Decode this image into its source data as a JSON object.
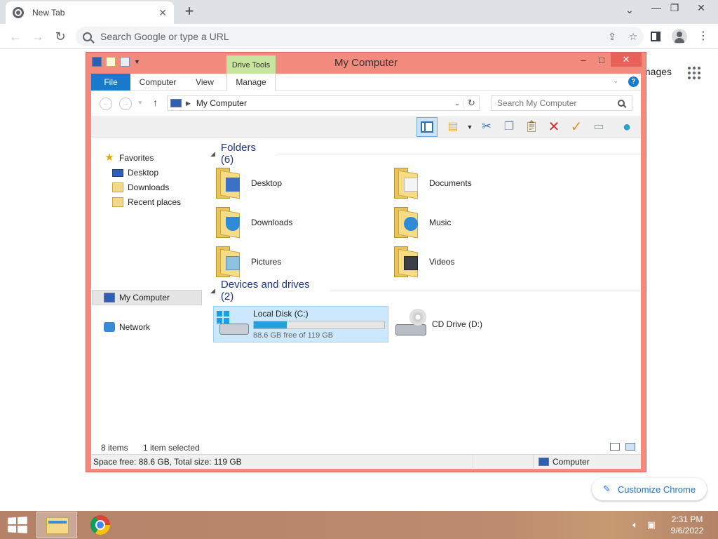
{
  "browser": {
    "tab_title": "New Tab",
    "tab_close": "✕",
    "new_tab": "+",
    "omnibox_placeholder": "Search Google or type a URL",
    "ntp_images_link": "mages",
    "customize_label": "Customize Chrome"
  },
  "explorer": {
    "title": "My Computer",
    "contextual_tab": "Drive Tools",
    "ribbon_tabs": [
      "File",
      "Computer",
      "View",
      "Manage"
    ],
    "address_text": "My Computer",
    "search_placeholder": "Search My Computer",
    "nav": {
      "favorites": "Favorites",
      "desktop": "Desktop",
      "downloads": "Downloads",
      "recent": "Recent places",
      "my_computer": "My Computer",
      "network": "Network"
    },
    "folders_header": "Folders (6)",
    "folders": [
      "Desktop",
      "Documents",
      "Downloads",
      "Music",
      "Pictures",
      "Videos"
    ],
    "devices_header": "Devices and drives (2)",
    "drive_c": {
      "name": "Local Disk (C:)",
      "free_text": "88.6 GB free of 119 GB",
      "used_fraction": 0.255
    },
    "drive_d": {
      "name": "CD Drive (D:)"
    },
    "status_items": "8 items",
    "status_selected": "1 item selected",
    "details_space": "Space free: 88.6 GB, Total size: 119 GB",
    "details_location": "Computer"
  },
  "taskbar": {
    "time": "2:31 PM",
    "date": "9/6/2022"
  },
  "colors": {
    "window_frame": "#f28b7e",
    "file_tab": "#1979ca",
    "drive_tools": "#c7e59f",
    "selection": "#cce8ff",
    "capacity_bar": "#26a0da"
  }
}
